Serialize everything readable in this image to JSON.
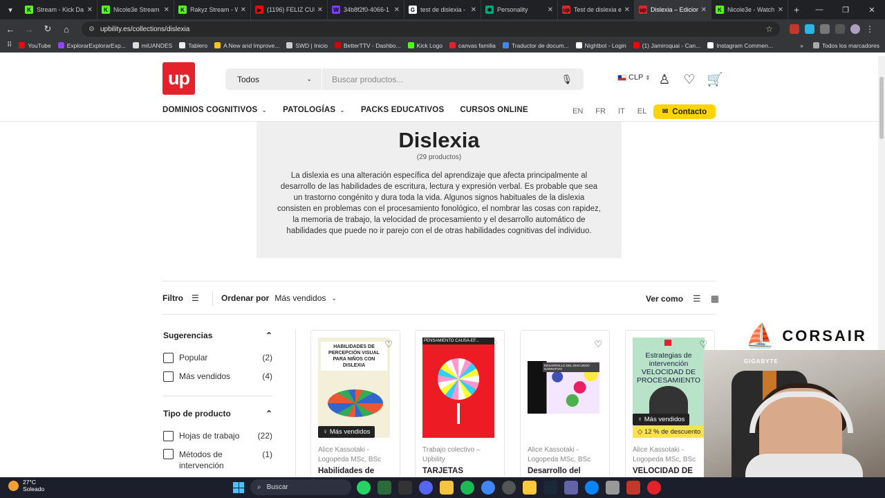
{
  "browser": {
    "tabs": [
      {
        "title": "Stream - Kick Da",
        "color": "#53fc18",
        "glyph": "K"
      },
      {
        "title": "Nicole3e Stream",
        "color": "#53fc18",
        "glyph": "K"
      },
      {
        "title": "Rakyz Stream - W",
        "color": "#53fc18",
        "glyph": "K"
      },
      {
        "title": "(1196) FELIZ CUM",
        "color": "#ff0000",
        "glyph": "▶"
      },
      {
        "title": "34b8f2f0-4066-1",
        "color": "#7a3cff",
        "glyph": "W"
      },
      {
        "title": "test de dislexia -",
        "color": "#ffffff",
        "glyph": "G"
      },
      {
        "title": "Personality",
        "color": "#00a67e",
        "glyph": "✱"
      },
      {
        "title": "Test de dislexia en",
        "color": "#e4222b",
        "glyph": "up"
      },
      {
        "title": "Dislexia – Edicion",
        "color": "#e4222b",
        "glyph": "up"
      },
      {
        "title": "Nicole3e - Watch",
        "color": "#53fc18",
        "glyph": "K"
      }
    ],
    "url": "upbility.es/collections/dislexia",
    "bookmarks": [
      {
        "label": "YouTube",
        "color": "#ff0000"
      },
      {
        "label": "ExplorarExplorarExp...",
        "color": "#9146ff"
      },
      {
        "label": "miUANDES",
        "color": "#dddddd"
      },
      {
        "label": "Tablero",
        "color": "#eeeeee"
      },
      {
        "label": "A New and Improve...",
        "color": "#f5c518"
      },
      {
        "label": "SWD | Inicio",
        "color": "#cccccc"
      },
      {
        "label": "BetterTTV - Dashbo...",
        "color": "#d50000"
      },
      {
        "label": "Kick Logo",
        "color": "#53fc18"
      },
      {
        "label": "canvas familia",
        "color": "#e4222b"
      },
      {
        "label": "Traductor de docum...",
        "color": "#4285f4"
      },
      {
        "label": "Nightbot - Login",
        "color": "#ffffff"
      },
      {
        "label": "(1) Jamiroquai - Can...",
        "color": "#ff0000"
      },
      {
        "label": "Instagram Commen...",
        "color": "#ffffff"
      }
    ],
    "all_bookmarks": "Todos los marcadores"
  },
  "header": {
    "logo": "up",
    "search_category": "Todos",
    "search_placeholder": "Buscar productos...",
    "currency": "CLP",
    "menu": [
      "DOMINIOS COGNITIVOS",
      "PATOLOGÍAS",
      "PACKS EDUCATIVOS",
      "CURSOS ONLINE"
    ],
    "languages": [
      "EN",
      "FR",
      "IT",
      "EL"
    ],
    "contact": "Contacto"
  },
  "collection": {
    "title": "Dislexia",
    "count": "(29 productos)",
    "description": "La dislexia es una alteración específica del aprendizaje que afecta principalmente al desarrollo de las habilidades de escritura, lectura y expresión verbal. Es probable que sea un trastorno congénito y dura toda la vida. Algunos signos habituales de la dislexia consisten en problemas con el procesamiento fonológico, el nombrar las cosas con rapidez, la memoria de trabajo, la velocidad de procesamiento y el desarrollo automático de habilidades que puede no ir parejo con el de otras habilidades cognitivas del individuo."
  },
  "toolbar": {
    "filter": "Filtro",
    "order_label": "Ordenar por",
    "order_value": "Más vendidos",
    "view_label": "Ver como"
  },
  "sidebar": {
    "sections": [
      {
        "title": "Sugerencias",
        "options": [
          {
            "label": "Popular",
            "count": "(2)"
          },
          {
            "label": "Más vendidos",
            "count": "(4)"
          }
        ]
      },
      {
        "title": "Tipo de producto",
        "options": [
          {
            "label": "Hojas de trabajo",
            "count": "(22)"
          },
          {
            "label": "Métodos de intervención",
            "count": "(1)"
          }
        ]
      }
    ]
  },
  "products": [
    {
      "author": "Alice Kassotaki - Logopeda MSc, BSc",
      "title": "Habilidades de",
      "badge": "Más vendidos",
      "cover": "HABILIDADES DE PERCEPCIÓN VISUAL PARA NIÑOS CON DISLEXIA"
    },
    {
      "author": "Trabajo colectivo – Upbility",
      "title": "TARJETAS",
      "cover": "PENSAMIENTO CAUSA-EF..."
    },
    {
      "author": "Alice Kassotaki - Logopeda MSc, BSc",
      "title": "Desarrollo del",
      "cover": "DESARROLLO DEL DISCURSO NARRATIVO"
    },
    {
      "author": "Alice Kassotaki - Logopeda MSc, BSc",
      "title": "VELOCIDAD DE",
      "badge": "Más vendidos",
      "discount": "12 % de descuento",
      "cover": "Estrategias de intervención VELOCIDAD DE PROCESAMIENTO"
    }
  ],
  "overlay": {
    "sponsor": "CORSAIR",
    "webcam_label": "GIGABYTE"
  },
  "taskbar": {
    "temp": "27°C",
    "weather": "Soleado",
    "search": "Buscar"
  }
}
